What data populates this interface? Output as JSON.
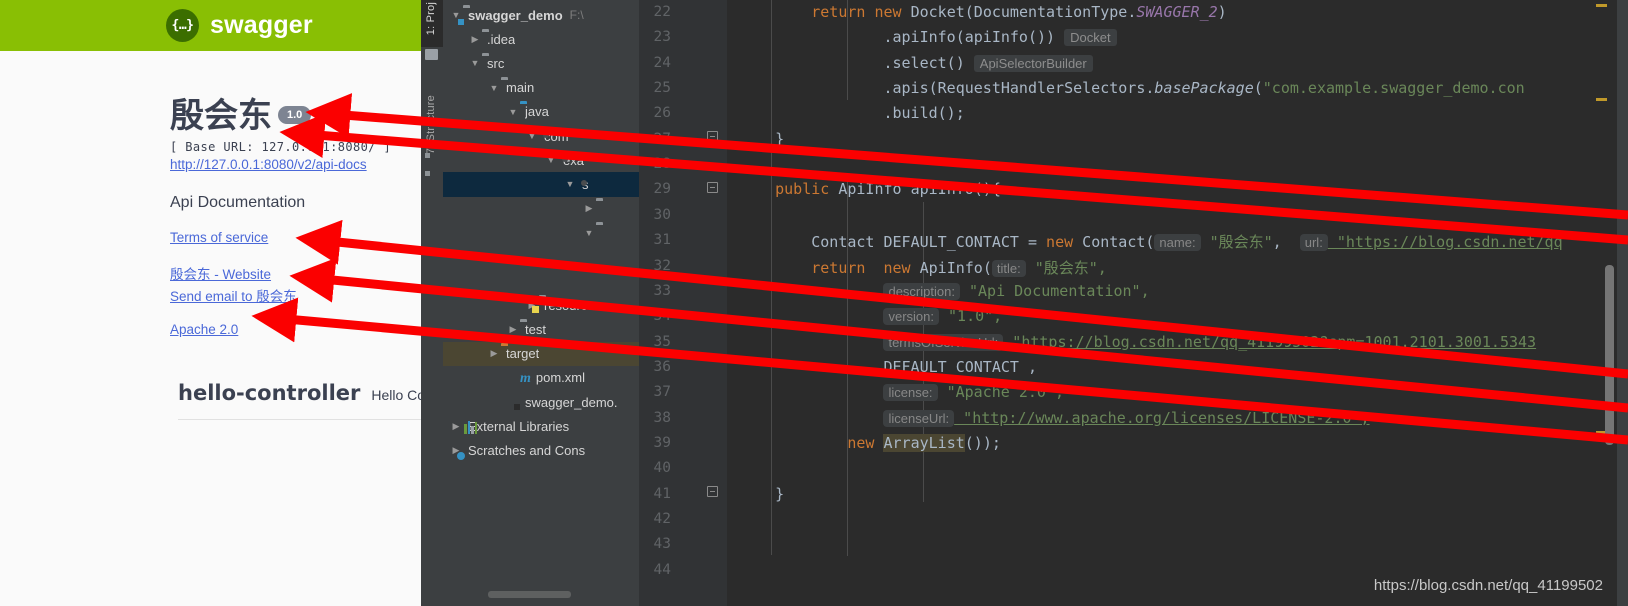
{
  "swagger": {
    "brand": "swagger",
    "logo_glyph": "{…}",
    "title": "殷会东",
    "version_badge": "1.0",
    "base_url": "[ Base URL: 127.0.0.1:8080/ ]",
    "api_docs_link": "http://127.0.0.1:8080/v2/api-docs",
    "description": "Api Documentation",
    "terms_link": "Terms of service",
    "website_link": "殷会东 - Website",
    "email_link": "Send email to 殷会东",
    "license_link": "Apache 2.0",
    "operation_tag": "hello-controller",
    "operation_tag_desc": "Hello Contr",
    "accent_color": "#89bf04",
    "link_color": "#4a68d8",
    "badge_color": "#7d8492"
  },
  "ide": {
    "tool_window_project": "1: Proj",
    "tool_window_structure": "7: Structure",
    "project_root": "swagger_demo",
    "project_path": "F:\\",
    "tree": [
      {
        "label": "swagger_demo",
        "path": "F:\\",
        "depth": 0,
        "toggle": "open",
        "icon": "folder-module",
        "bold": true,
        "state": "normal"
      },
      {
        "label": ".idea",
        "path": "",
        "depth": 1,
        "toggle": "closed",
        "icon": "folder",
        "bold": false,
        "state": "normal"
      },
      {
        "label": "src",
        "path": "",
        "depth": 1,
        "toggle": "open",
        "icon": "folder",
        "bold": false,
        "state": "normal"
      },
      {
        "label": "main",
        "path": "",
        "depth": 2,
        "toggle": "open",
        "icon": "folder",
        "bold": false,
        "state": "normal"
      },
      {
        "label": "java",
        "path": "",
        "depth": 3,
        "toggle": "open",
        "icon": "folder-blue",
        "bold": false,
        "state": "normal"
      },
      {
        "label": "com",
        "path": "",
        "depth": 4,
        "toggle": "open",
        "icon": "package",
        "bold": false,
        "state": "normal"
      },
      {
        "label": "exa",
        "path": "",
        "depth": 5,
        "toggle": "open",
        "icon": "package",
        "bold": false,
        "state": "normal"
      },
      {
        "label": "s",
        "path": "",
        "depth": 6,
        "toggle": "open",
        "icon": "package",
        "bold": false,
        "state": "selected"
      },
      {
        "label": "",
        "path": "",
        "depth": 7,
        "toggle": "closed",
        "icon": "folder",
        "bold": false,
        "state": "normal"
      },
      {
        "label": "",
        "path": "",
        "depth": 7,
        "toggle": "open",
        "icon": "folder",
        "bold": false,
        "state": "normal"
      },
      {
        "label": "",
        "path": "",
        "depth": 8,
        "toggle": "none",
        "icon": "none",
        "bold": false,
        "state": "normal"
      },
      {
        "label": "",
        "path": "",
        "depth": 8,
        "toggle": "none",
        "icon": "none",
        "bold": false,
        "state": "normal"
      },
      {
        "label": "resources",
        "path": "",
        "depth": 4,
        "toggle": "closed",
        "icon": "resources",
        "bold": false,
        "state": "normal"
      },
      {
        "label": "test",
        "path": "",
        "depth": 3,
        "toggle": "closed",
        "icon": "folder",
        "bold": false,
        "state": "normal"
      },
      {
        "label": "target",
        "path": "",
        "depth": 2,
        "toggle": "closed",
        "icon": "folder-orange",
        "bold": false,
        "state": "target"
      },
      {
        "label": "pom.xml",
        "path": "",
        "depth": 3,
        "toggle": "none",
        "icon": "maven",
        "bold": false,
        "state": "normal"
      },
      {
        "label": "swagger_demo.",
        "path": "",
        "depth": 3,
        "toggle": "none",
        "icon": "iml",
        "bold": false,
        "state": "normal"
      },
      {
        "label": "External Libraries",
        "path": "",
        "depth": 0,
        "toggle": "closed",
        "icon": "libs",
        "bold": false,
        "state": "normal"
      },
      {
        "label": "Scratches and Cons",
        "path": "",
        "depth": 0,
        "toggle": "closed",
        "icon": "scratch",
        "bold": false,
        "state": "normal"
      }
    ],
    "line_numbers": [
      22,
      23,
      24,
      25,
      26,
      27,
      28,
      29,
      30,
      31,
      32,
      33,
      34,
      35,
      36,
      37,
      38,
      39,
      40,
      41,
      42,
      43,
      44
    ],
    "code": {
      "l22": {
        "indent": "        ",
        "parts": [
          {
            "t": "return ",
            "c": "kw"
          },
          {
            "t": "new ",
            "c": "kw"
          },
          {
            "t": "Docket(DocumentationType.",
            "c": "pl"
          },
          {
            "t": "SWAGGER_2",
            "c": "fld"
          },
          {
            "t": ")",
            "c": "pl"
          }
        ]
      },
      "l23": {
        "indent": "                ",
        "parts": [
          {
            "t": ".apiInfo(apiInfo()) ",
            "c": "pl"
          },
          {
            "t": "Docket",
            "c": "tip"
          }
        ]
      },
      "l24": {
        "indent": "                ",
        "parts": [
          {
            "t": ".select() ",
            "c": "pl"
          },
          {
            "t": "ApiSelectorBuilder",
            "c": "tip"
          }
        ]
      },
      "l25": {
        "indent": "                ",
        "parts": [
          {
            "t": ".apis(RequestHandlerSelectors.",
            "c": "pl"
          },
          {
            "t": "basePackage",
            "c": "itm"
          },
          {
            "t": "(",
            "c": "pl"
          },
          {
            "t": "\"com.example.swagger_demo.con",
            "c": "st"
          }
        ]
      },
      "l26": {
        "indent": "                ",
        "parts": [
          {
            "t": ".build();",
            "c": "pl"
          }
        ]
      },
      "l27": {
        "indent": "    ",
        "parts": [
          {
            "t": "}",
            "c": "pl"
          }
        ]
      },
      "l29": {
        "indent": "    ",
        "parts": [
          {
            "t": "public ",
            "c": "kw"
          },
          {
            "t": "ApiInfo ",
            "c": "pl"
          },
          {
            "t": "apiInfo",
            "c": "mth"
          },
          {
            "t": "(){",
            "c": "pl"
          }
        ]
      },
      "l31": {
        "indent": "        ",
        "parts": [
          {
            "t": "Contact DEFAULT_CONTACT = ",
            "c": "pl"
          },
          {
            "t": "new ",
            "c": "kw"
          },
          {
            "t": "Contact(",
            "c": "pl"
          },
          {
            "t": "name:",
            "c": "hint"
          },
          {
            "t": " \"殷会东\"",
            "c": "st"
          },
          {
            "t": ",  ",
            "c": "pl"
          },
          {
            "t": "url:",
            "c": "hint"
          },
          {
            "t": " \"https://blog.csdn.net/qq",
            "c": "stl"
          }
        ]
      },
      "l32": {
        "indent": "        ",
        "parts": [
          {
            "t": "return  ",
            "c": "kw"
          },
          {
            "t": "new ",
            "c": "kw"
          },
          {
            "t": "ApiInfo(",
            "c": "pl"
          },
          {
            "t": "title:",
            "c": "hint"
          },
          {
            "t": " \"殷会东\",",
            "c": "st"
          }
        ]
      },
      "l33": {
        "indent": "                ",
        "parts": [
          {
            "t": "description:",
            "c": "hint"
          },
          {
            "t": " \"Api Documentation\",",
            "c": "st"
          }
        ]
      },
      "l34": {
        "indent": "                ",
        "parts": [
          {
            "t": "version:",
            "c": "hint"
          },
          {
            "t": " \"1.0\",",
            "c": "st"
          }
        ]
      },
      "l35": {
        "indent": "                ",
        "parts": [
          {
            "t": "termsOfServiceUrl:",
            "c": "hint"
          },
          {
            "t": " \"https://blog.csdn.net/qq_41199502?spm=1001.2101.3001.5343",
            "c": "stl"
          }
        ]
      },
      "l36": {
        "indent": "                ",
        "parts": [
          {
            "t": "DEFAULT_CONTACT ,",
            "c": "pl"
          }
        ]
      },
      "l37": {
        "indent": "                ",
        "parts": [
          {
            "t": "license:",
            "c": "hint"
          },
          {
            "t": " \"Apache 2.0\",",
            "c": "st"
          }
        ]
      },
      "l38": {
        "indent": "                ",
        "parts": [
          {
            "t": "licenseUrl:",
            "c": "hint"
          },
          {
            "t": " \"http://www.apache.org/licenses/LICENSE-2.0\",",
            "c": "stl"
          }
        ]
      },
      "l39": {
        "indent": "            ",
        "parts": [
          {
            "t": "new ",
            "c": "kw"
          },
          {
            "t": "ArrayList",
            "c": "hl"
          },
          {
            "t": "());",
            "c": "pl"
          }
        ]
      },
      "l41": {
        "indent": "    ",
        "parts": [
          {
            "t": "}",
            "c": "pl"
          }
        ]
      }
    },
    "watermark": "https://blog.csdn.net/qq_41199502",
    "arrow_color": "#fb0000"
  },
  "annotations": {
    "arrows": [
      {
        "from_label": "version-hint",
        "to_label": "version-badge"
      },
      {
        "from_label": "title-hint",
        "to_label": "page-title"
      },
      {
        "from_label": "termsOfServiceUrl-hint",
        "to_label": "terms-of-service-link"
      },
      {
        "from_label": "description-hint",
        "to_label": "website-link"
      },
      {
        "from_label": "license-hint",
        "to_label": "apache-license-link"
      }
    ]
  }
}
